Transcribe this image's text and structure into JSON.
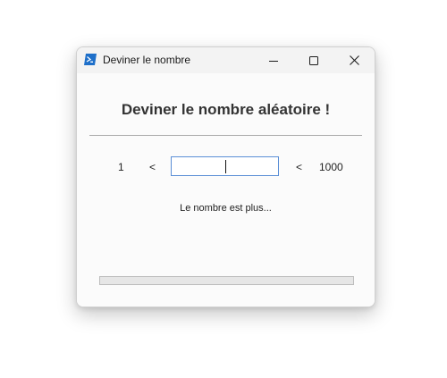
{
  "window": {
    "title": "Deviner le nombre",
    "icon": "powershell-icon",
    "controls": {
      "minimize_icon": "minimize-icon",
      "maximize_icon": "maximize-icon",
      "close_icon": "close-icon"
    }
  },
  "main": {
    "heading": "Deviner le nombre aléatoire !",
    "range": {
      "min": "1",
      "less_than_left": "<",
      "less_than_right": "<",
      "max": "1000"
    },
    "guess_input": {
      "value": ""
    },
    "hint": "Le nombre est plus...",
    "progress": {
      "value": 0
    }
  },
  "colors": {
    "accent": "#5b8fd6",
    "icon_blue": "#1e6fc9",
    "titlebar": "#f3f3f3"
  }
}
